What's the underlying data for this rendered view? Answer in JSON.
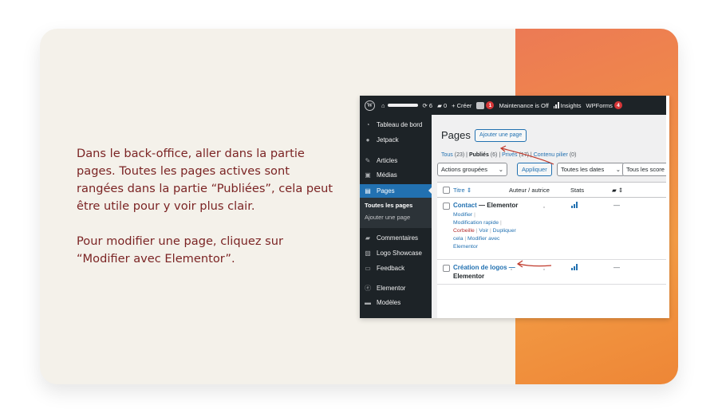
{
  "intro": {
    "paragraph1": "Dans le back-office, aller dans la partie pages. Toutes les pages actives sont rangées dans la partie “Publiées”, cela peut être utile pour y voir plus clair.",
    "paragraph2": "Pour modifier une page, cliquez sur “Modifier avec Elementor”."
  },
  "colors": {
    "text": "#7b2424",
    "card_bg": "#f4f1ea",
    "accent_orange": "#f08a48",
    "wp_admin_dark": "#1d2327",
    "wp_blue": "#2271b1",
    "annotation_red": "#c0392b"
  },
  "topbar": {
    "updates_count": "6",
    "comments_count": "0",
    "create_label": "Créer",
    "yoast_badge": "1",
    "maintenance_label": "Maintenance is Off",
    "insights_label": "Insights",
    "wpforms_label": "WPForms",
    "wpforms_badge": "4"
  },
  "sidebar": {
    "items": [
      {
        "label": "Tableau de bord",
        "icon": "dashboard-icon"
      },
      {
        "label": "Jetpack",
        "icon": "jetpack-icon"
      },
      {
        "label": "Articles",
        "icon": "pin-icon"
      },
      {
        "label": "Médias",
        "icon": "media-icon"
      },
      {
        "label": "Pages",
        "icon": "pages-icon"
      },
      {
        "label": "Commentaires",
        "icon": "comment-icon"
      },
      {
        "label": "Logo Showcase",
        "icon": "image-icon"
      },
      {
        "label": "Feedback",
        "icon": "feedback-icon"
      },
      {
        "label": "Elementor",
        "icon": "elementor-icon"
      },
      {
        "label": "Modèles",
        "icon": "folder-icon"
      }
    ],
    "submenu": [
      "Toutes les pages",
      "Ajouter une page"
    ]
  },
  "main": {
    "title": "Pages",
    "add_button": "Ajouter une page",
    "filters": {
      "all": "Tous",
      "all_count": "(23)",
      "published": "Publiés",
      "published_count": "(6)",
      "private": "Privés",
      "private_count": "(17)",
      "pillar": "Contenu pilier",
      "pillar_count": "(0)"
    },
    "bulk_actions": "Actions groupées",
    "apply": "Appliquer",
    "all_dates": "Toutes les dates",
    "all_scores": "Tous les score",
    "columns": [
      "Titre",
      "Auteur / autrice",
      "Stats"
    ],
    "rows": [
      {
        "title": "Contact",
        "suffix": "— Elementor",
        "actions": [
          "Modifier",
          "Modification rapide",
          "Corbeille",
          "Voir",
          "Dupliquer cela",
          "Modifier avec Elementor"
        ],
        "comments": "—"
      },
      {
        "title": "Création de logos —",
        "suffix": "Elementor",
        "comments": "—"
      }
    ]
  }
}
